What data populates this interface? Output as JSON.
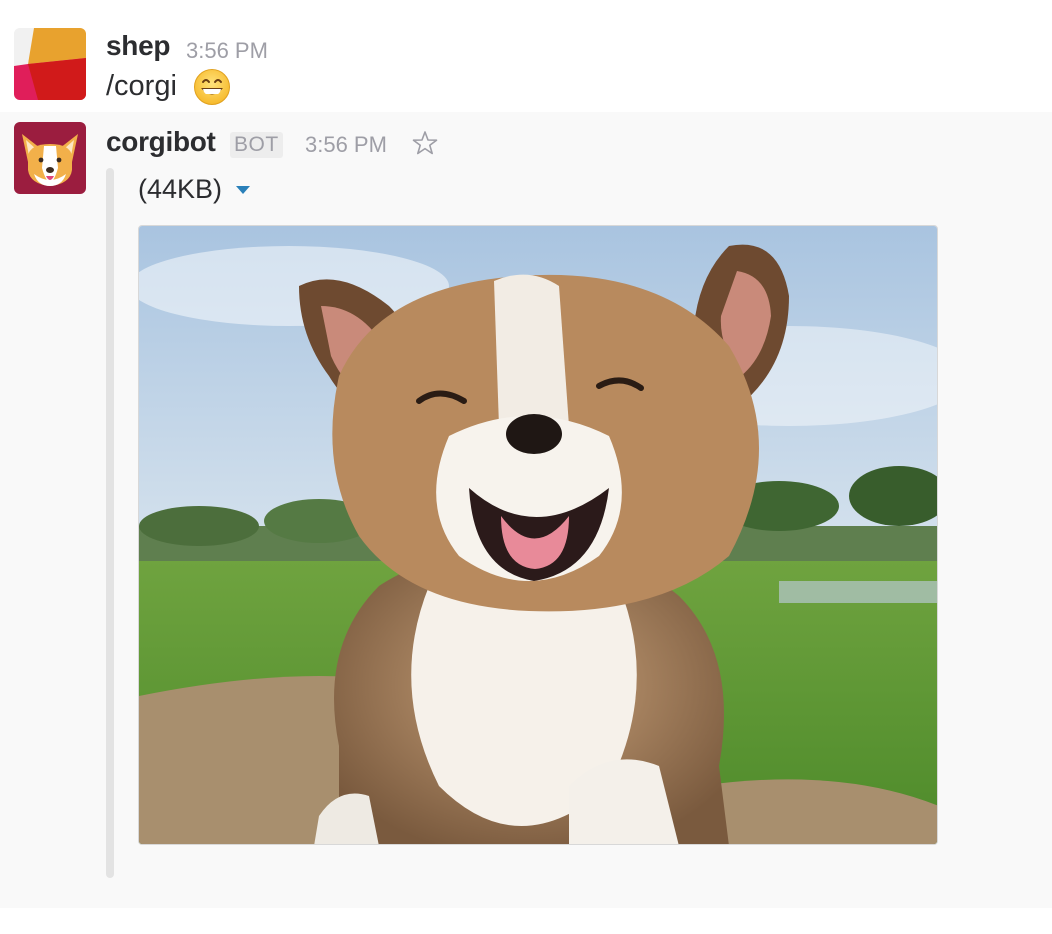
{
  "messages": [
    {
      "author": "shep",
      "time": "3:56 PM",
      "text": "/corgi",
      "avatar_icon": "shep-avatar-icon",
      "emoji_icon": "grinning-emoji-icon"
    },
    {
      "author": "corgibot",
      "badge": "BOT",
      "time": "3:56 PM",
      "avatar_icon": "corgi-avatar-icon",
      "star_icon": "star-outline-icon",
      "attachment": {
        "file_size": "(44KB)",
        "toggle_icon": "caret-down-icon",
        "image_alt": "corgi-puppy-photo"
      }
    }
  ],
  "colors": {
    "accent_blue": "#2a80b9",
    "bot_row_bg": "#f9f9f9",
    "timestamp": "#9e9ea6"
  }
}
